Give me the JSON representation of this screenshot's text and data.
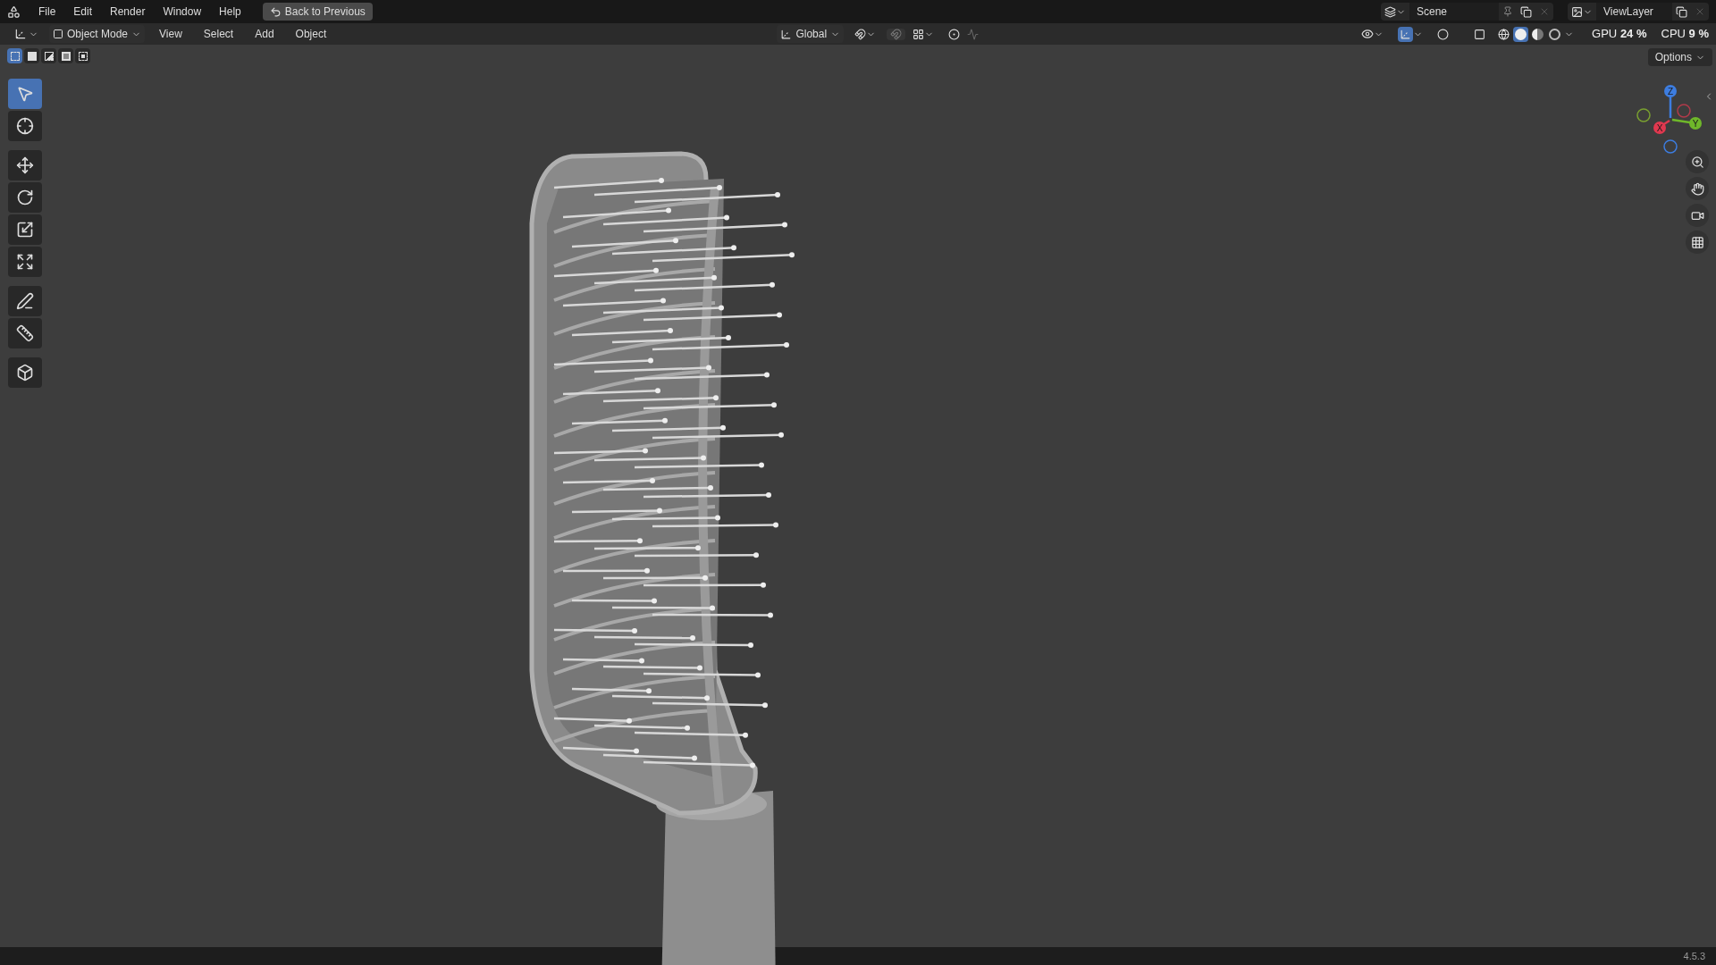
{
  "menu": [
    "File",
    "Edit",
    "Render",
    "Window",
    "Help"
  ],
  "back_button": "Back to Previous",
  "scene": "Scene",
  "view_layer": "ViewLayer",
  "stats": [
    {
      "label": "GPU",
      "value": "24 %"
    },
    {
      "label": "CPU",
      "value": "9 %"
    }
  ],
  "header": {
    "mode": "Object Mode",
    "menus": [
      "View",
      "Select",
      "Add",
      "Object"
    ],
    "orientation": "Global",
    "options": "Options"
  },
  "select_modes": [
    {
      "kind": "new",
      "selected": true
    },
    {
      "kind": "extend",
      "selected": false
    },
    {
      "kind": "subtract",
      "selected": false
    },
    {
      "kind": "invert",
      "selected": false
    },
    {
      "kind": "intersect",
      "selected": false
    }
  ],
  "tools": [
    {
      "kind": "select",
      "selected": true
    },
    {
      "kind": "cursor",
      "selected": false
    },
    {
      "kind": "move",
      "selected": false
    },
    {
      "kind": "rotate",
      "selected": false
    },
    {
      "kind": "scale",
      "selected": false
    },
    {
      "kind": "transform",
      "selected": false
    },
    {
      "kind": "annotate",
      "selected": false
    },
    {
      "kind": "measure",
      "selected": false
    },
    {
      "kind": "add-cube",
      "selected": false
    }
  ],
  "shading": [
    {
      "kind": "wireframe",
      "selected": false
    },
    {
      "kind": "solid",
      "selected": true
    },
    {
      "kind": "material",
      "selected": false
    },
    {
      "kind": "rendered",
      "selected": false
    }
  ],
  "gizmo": {
    "z": "Z",
    "x": "X",
    "y": "Y"
  },
  "version": "4.5.3"
}
